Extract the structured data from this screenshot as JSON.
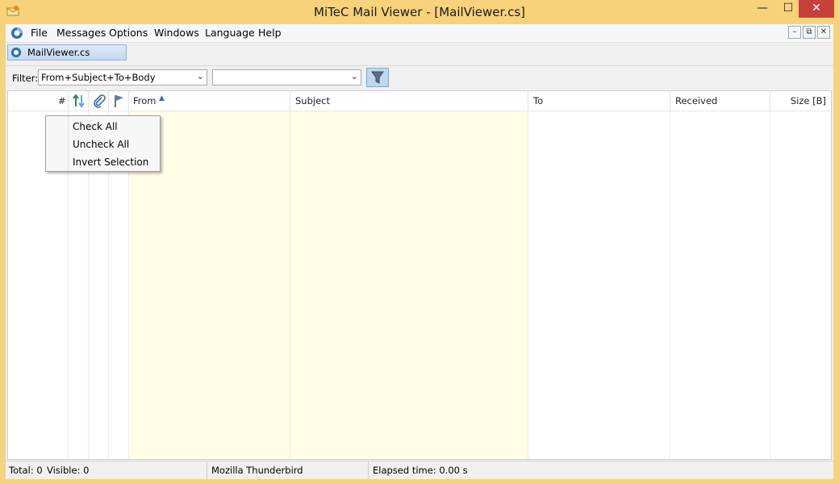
{
  "window": {
    "title": "MiTeC Mail Viewer - [MailViewer.cs]",
    "controls": {
      "minimize": "—",
      "maximize": "☐",
      "close": "✕"
    }
  },
  "menubar": {
    "items": [
      "File",
      "Messages",
      "Options",
      "Windows",
      "Language",
      "Help"
    ],
    "mdi_controls": {
      "minimize": "–",
      "restore": "⧉",
      "close": "✕"
    }
  },
  "tabs": [
    {
      "label": "MailViewer.cs",
      "active": true
    }
  ],
  "filter": {
    "label": "Filter:",
    "field_value": "From+Subject+To+Body",
    "search_value": ""
  },
  "grid": {
    "columns": [
      {
        "id": "number",
        "label": "#"
      },
      {
        "id": "direction",
        "label": "",
        "icon": "up-down-arrows-icon"
      },
      {
        "id": "attachment",
        "label": "",
        "icon": "paperclip-icon"
      },
      {
        "id": "flag",
        "label": "",
        "icon": "flag-icon"
      },
      {
        "id": "from",
        "label": "From",
        "sorted": "ascending"
      },
      {
        "id": "subject",
        "label": "Subject"
      },
      {
        "id": "to",
        "label": "To"
      },
      {
        "id": "received",
        "label": "Received"
      },
      {
        "id": "size",
        "label": "Size [B]"
      }
    ],
    "rows": []
  },
  "context_menu": {
    "items": [
      "Check All",
      "Uncheck All",
      "Invert Selection"
    ]
  },
  "statusbar": {
    "total": "Total: 0",
    "visible": "Visible: 0",
    "source": "Mozilla Thunderbird",
    "elapsed": "Elapsed time: 0.00 s"
  },
  "colors": {
    "titlebar": "#f7d27a",
    "close_button": "#c7413b",
    "highlight_column": "#fffde5",
    "filter_button": "#bfd7ef"
  }
}
